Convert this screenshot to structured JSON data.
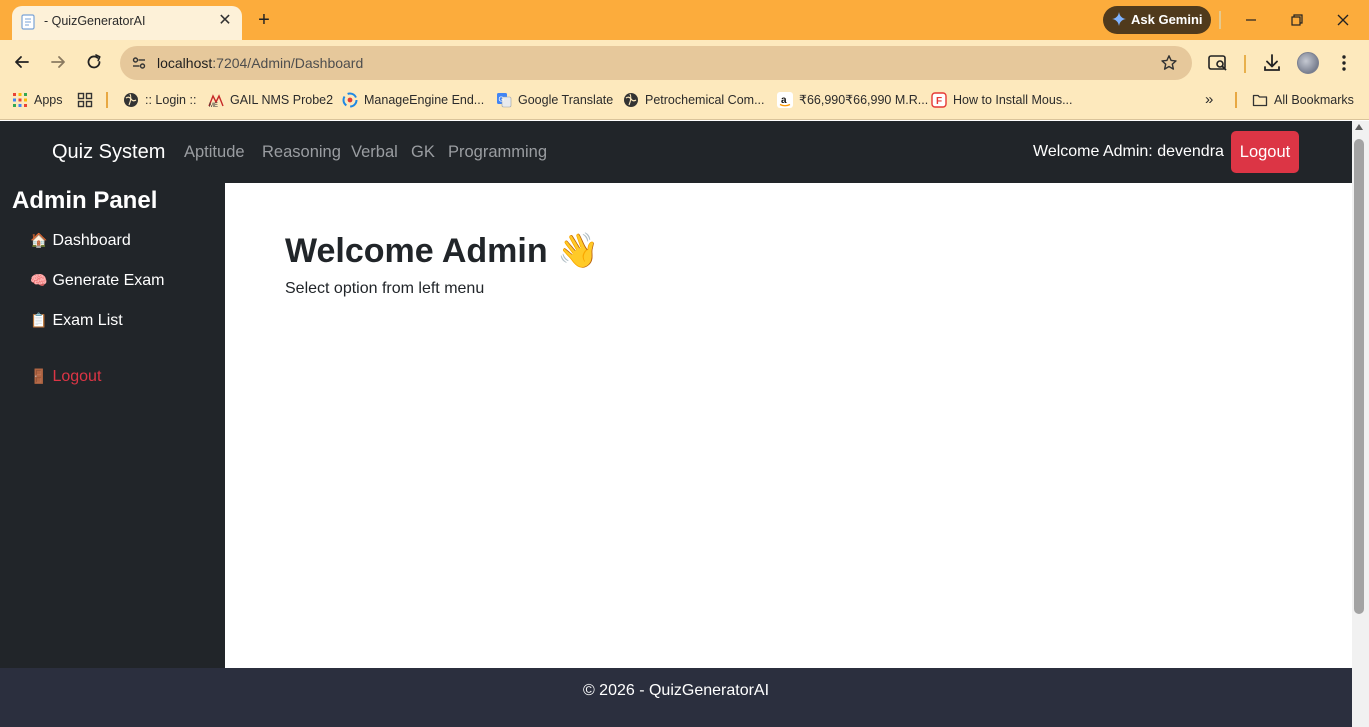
{
  "browser": {
    "tab_title": "- QuizGeneratorAI",
    "tab_close": "✕",
    "new_tab": "+",
    "ask_gemini": "Ask Gemini",
    "url_host": "localhost",
    "url_path": ":7204/Admin/Dashboard",
    "bookmarks": [
      {
        "label": "Apps",
        "icon": "apps-grid-icon"
      },
      {
        "label": "",
        "icon": "tab-groups-icon"
      },
      {
        "label": ":: Login ::",
        "icon": "globe-icon"
      },
      {
        "label": "GAIL NMS Probe2",
        "icon": "manageengine-icon"
      },
      {
        "label": "ManageEngine End...",
        "icon": "manageengine-endpoint-icon"
      },
      {
        "label": "Google Translate",
        "icon": "google-translate-icon"
      },
      {
        "label": "Petrochemical Com...",
        "icon": "globe-icon"
      },
      {
        "label": "₹66,990₹66,990 M.R...",
        "icon": "amazon-icon"
      },
      {
        "label": "How to Install Mous...",
        "icon": "f-icon"
      }
    ],
    "bookmarks_more": "»",
    "all_bookmarks": "All Bookmarks"
  },
  "navbar": {
    "brand": "Quiz System",
    "links": [
      "Aptitude",
      "Reasoning",
      "Verbal",
      "GK",
      "Programming"
    ],
    "welcome": "Welcome Admin: devendra",
    "logout": "Logout"
  },
  "sidebar": {
    "title": "Admin Panel",
    "items": [
      {
        "icon": "🏠",
        "label": "Dashboard"
      },
      {
        "icon": "🧠",
        "label": "Generate Exam"
      },
      {
        "icon": "📋",
        "label": "Exam List"
      }
    ],
    "logout": {
      "icon": "🚪",
      "label": "Logout"
    }
  },
  "main": {
    "heading": "Welcome Admin 👋",
    "subtext": "Select option from left menu"
  },
  "footer": {
    "text": "© 2026 - QuizGeneratorAI"
  },
  "colors": {
    "tabbar": "#fcac3c",
    "toolbar": "#fde9bd",
    "navbar": "#212529",
    "danger": "#dc3545",
    "footer": "#2b2f3e"
  }
}
